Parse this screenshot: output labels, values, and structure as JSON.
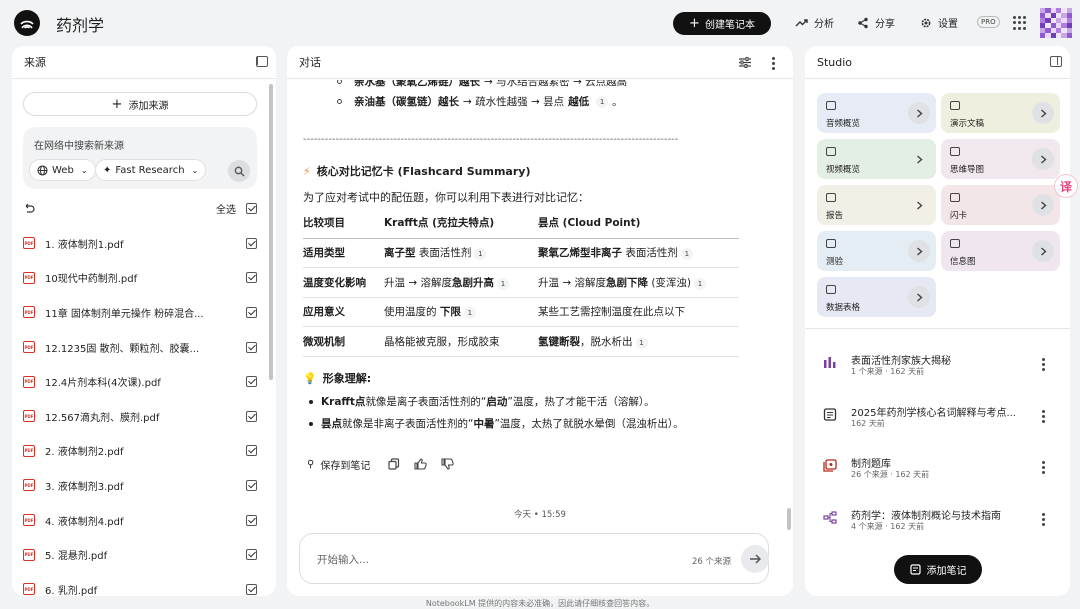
{
  "header": {
    "title": "药剂学",
    "create_notebook": "创建笔记本",
    "analyze": "分析",
    "share": "分享",
    "settings": "设置",
    "badge": "PRO"
  },
  "sources": {
    "title": "来源",
    "add_source": "添加来源",
    "search_placeholder": "在网络中搜索新来源",
    "chip_web": "Web",
    "chip_research": "Fast Research",
    "select_all": "全选",
    "items": [
      "1. 液体制剂1.pdf",
      "10现代中药制剂.pdf",
      "11章 固体制剂单元操作 粉碎混合...",
      "12.1235固 散剂、颗粒剂、胶囊...",
      "12.4片剂本科(4次课).pdf",
      "12.567滴丸剂、膜剂.pdf",
      "2. 液体制剂2.pdf",
      "3. 液体制剂3.pdf",
      "4. 液体制剂4.pdf",
      "5. 混悬剂.pdf",
      "6. 乳剂.pdf"
    ]
  },
  "chat": {
    "title": "对话",
    "top_line_1_label": "亲水基（聚氧乙烯链）越长",
    "top_line_1_rest": "→ 与水结合越紧密 → 云点越高",
    "top_line_2_label": "亲油基（碳氢链）越长",
    "top_line_2_mid": "→ 疏水性越强 → 昙点",
    "top_line_2_bold": "越低",
    "ref1": "1",
    "dashes": "--------------------------------------------------------------------------------------------------------",
    "flashcard_title": "核心对比记忆卡 (Flashcard Summary)",
    "intro": "为了应对考试中的配伍题，你可以利用下表进行对比记忆：",
    "table_headers": [
      "比较项目",
      "Krafft点 (克拉夫特点)",
      "昙点 (Cloud Point)"
    ],
    "rows": [
      {
        "item": "适用类型",
        "k_bold": "离子型",
        "k_rest": " 表面活性剂",
        "k_ref": "1",
        "c_bold": "聚氧乙烯型非离子",
        "c_rest": " 表面活性剂",
        "c_ref": "1"
      },
      {
        "item": "温度变化影响",
        "k_pre": "升温 → 溶解度",
        "k_bold": "急剧升高",
        "k_ref": "1",
        "c_pre": "升温 → 溶解度",
        "c_bold": "急剧下降",
        "c_rest": " (变浑浊)",
        "c_ref": "1"
      },
      {
        "item": "应用意义",
        "k_pre": "使用温度的 ",
        "k_bold": "下限",
        "k_ref": "1",
        "c_pre": "某些工艺需控制温度在此点以下"
      },
      {
        "item": "微观机制",
        "k_pre": "晶格能被克服，形成胶束",
        "c_bold": "氢键断裂",
        "c_rest": "，脱水析出",
        "c_ref": "1"
      }
    ],
    "image_title": "形象理解:",
    "bullet1_bold": "Krafft点",
    "bullet1_pre": " 就像是离子表面活性剂的“",
    "bullet1_kw": "启动",
    "bullet1_post": "”温度，热了才能干活（溶解）。",
    "bullet2_bold": "昙点",
    "bullet2_pre": " 就像是非离子表面活性剂的“",
    "bullet2_kw": "中暑",
    "bullet2_post": "”温度，太热了就脱水晕倒（混浊析出）。",
    "save_to_note": "保存到笔记",
    "timestamp": "今天 • 15:59",
    "input_placeholder": "开始输入...",
    "source_count": "26 个来源"
  },
  "studio": {
    "title": "Studio",
    "tiles": [
      {
        "label": "音频概览",
        "color": "#e6ebf5"
      },
      {
        "label": "演示文稿",
        "color": "#efefdf"
      },
      {
        "label": "视频概览",
        "color": "#e3efe4"
      },
      {
        "label": "思维导图",
        "color": "#f1e7ee"
      },
      {
        "label": "报告",
        "color": "#f1efe6"
      },
      {
        "label": "闪卡",
        "color": "#f3e6e9"
      },
      {
        "label": "测验",
        "color": "#e4edf3"
      },
      {
        "label": "信息图",
        "color": "#efe6ef"
      },
      {
        "label": "数据表格",
        "color": "#e6e9f4"
      }
    ],
    "notes": [
      {
        "title": "表面活性剂家族大揭秘",
        "meta": "1 个来源 · 162 天前",
        "icon": "bar-chart-icon",
        "color": "#7b3f9e"
      },
      {
        "title": "2025年药剂学核心名词解释与考点...",
        "meta": "162 天前",
        "icon": "document-icon",
        "color": "#333333"
      },
      {
        "title": "制剂题库",
        "meta": "26 个来源 · 162 天前",
        "icon": "quiz-icon",
        "color": "#b3261e"
      },
      {
        "title": "药剂学：液体制剂概论与技术指南",
        "meta": "4 个来源 · 162 天前",
        "icon": "mind-map-icon",
        "color": "#7b3f9e"
      }
    ],
    "add_note": "添加笔记"
  },
  "footer": "NotebookLM 提供的内容未必准确，因此请仔细核查回答内容。"
}
